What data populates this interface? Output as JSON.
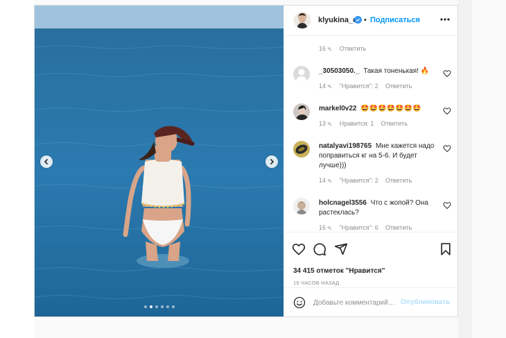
{
  "post": {
    "username": "klyukina_d",
    "separator": "•",
    "follow_label": "Подписаться",
    "carousel": {
      "slides": 6,
      "active": 1
    }
  },
  "comments": [
    {
      "meta_time": "16 ч.",
      "reply": "Ответить"
    },
    {
      "user": "_30503050._",
      "text": "Такая тоненькая! 🔥",
      "time": "14 ч.",
      "likes": "\"Нравится\": 2",
      "reply": "Ответить"
    },
    {
      "user": "markel0v22",
      "text": "🤩🤩🤩🤩🤩🤩🤩",
      "time": "13 ч.",
      "likes": "Нравится: 1",
      "reply": "Ответить"
    },
    {
      "user": "natalyavi198765",
      "text": "Мне кажется надо поправиться кг на 5-6. И будет лучше)))",
      "time": "14 ч.",
      "likes": "\"Нравится\": 2",
      "reply": "Ответить"
    },
    {
      "user": "holcnagel3556",
      "text": "Что с жопой? Она растеклась?",
      "time": "16 ч.",
      "likes": "\"Нравится\": 6",
      "reply": "Ответить"
    }
  ],
  "footer": {
    "likes_text": "34 415 отметок \"Нравится\"",
    "time_ago": "16 ЧАСОВ НАЗАД",
    "comment_placeholder": "Добавьте комментарий…",
    "publish_label": "Опубликовать"
  },
  "colors": {
    "link_blue": "#0095f6",
    "publish_disabled": "#b2dffc",
    "sea": "#1f6fa3"
  },
  "icons": [
    "heart-icon",
    "comment-icon",
    "share-icon",
    "bookmark-icon",
    "emoji-icon",
    "more-icon",
    "verified-icon",
    "chevron-left-icon",
    "chevron-right-icon"
  ]
}
